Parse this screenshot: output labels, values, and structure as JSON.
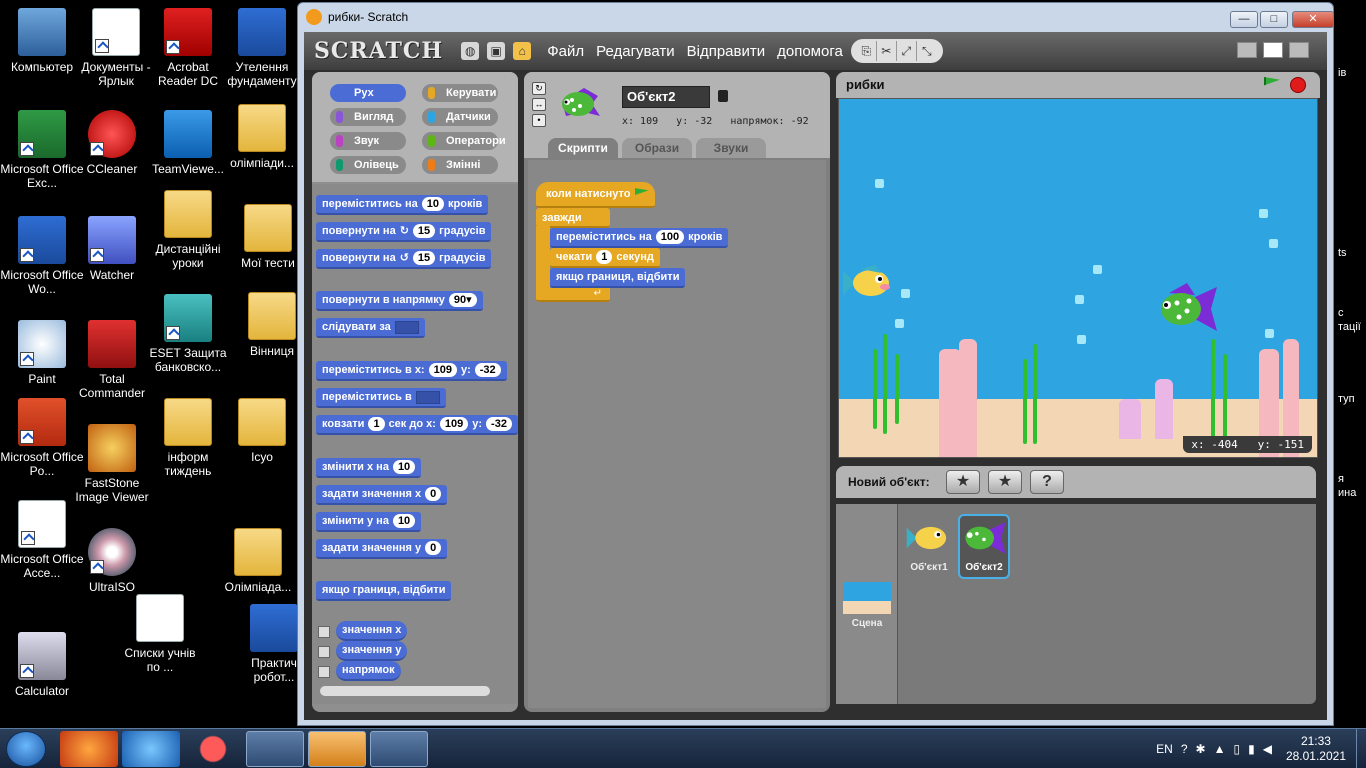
{
  "desktop": {
    "icons": [
      {
        "label": "Компьютер"
      },
      {
        "label": "Документы - Ярлык"
      },
      {
        "label": "Acrobat Reader DC"
      },
      {
        "label": "Утелення фундаменту"
      },
      {
        "label": "Microsoft Office Exc..."
      },
      {
        "label": "CCleaner"
      },
      {
        "label": "TeamViewe..."
      },
      {
        "label": "олімпіади..."
      },
      {
        "label": "Microsoft Office Wo..."
      },
      {
        "label": "Watcher"
      },
      {
        "label": "Дистанційні уроки"
      },
      {
        "label": "Мої тести"
      },
      {
        "label": "Paint"
      },
      {
        "label": "Total Commander"
      },
      {
        "label": "ESET Защита банковско..."
      },
      {
        "label": "Вінниця"
      },
      {
        "label": "Microsoft Office Po..."
      },
      {
        "label": "FastStone Image Viewer"
      },
      {
        "label": "інформ тиждень"
      },
      {
        "label": "Ісуо"
      },
      {
        "label": "Microsoft Office Acce..."
      },
      {
        "label": "UltraISO"
      },
      {
        "label": "Олімпіада..."
      },
      {
        "label": "Списки учнів по ..."
      },
      {
        "label": "Практич робот..."
      },
      {
        "label": "Calculator"
      }
    ],
    "right_edge": [
      "ів",
      "ts",
      "с",
      "тації",
      "туп",
      "я",
      "ина"
    ]
  },
  "window": {
    "title": "рибки- Scratch",
    "btn_min": "—",
    "btn_max": "□",
    "btn_close": "✕"
  },
  "menubar": {
    "logo": "SCRATCH",
    "items": [
      "Файл",
      "Редагувати",
      "Відправити",
      "допомога"
    ]
  },
  "categories": [
    {
      "label": "Рух",
      "color": "#4a6cd4",
      "selected": true
    },
    {
      "label": "Керувати",
      "color": "#e6a822",
      "selected": false
    },
    {
      "label": "Вигляд",
      "color": "#8a55d7",
      "selected": false
    },
    {
      "label": "Датчики",
      "color": "#2ca5e2",
      "selected": false
    },
    {
      "label": "Звук",
      "color": "#bb42c3",
      "selected": false
    },
    {
      "label": "Оператори",
      "color": "#5cb712",
      "selected": false
    },
    {
      "label": "Олівець",
      "color": "#0e9a6c",
      "selected": false
    },
    {
      "label": "Змінні",
      "color": "#ee7d16",
      "selected": false
    }
  ],
  "palette": {
    "move": {
      "a": "переміститись на",
      "v": "10",
      "b": "кроків"
    },
    "turn_cw": {
      "a": "повернути на",
      "icon": "↻",
      "v": "15",
      "b": "градусів"
    },
    "turn_ccw": {
      "a": "повернути на",
      "icon": "↺",
      "v": "15",
      "b": "градусів"
    },
    "point_dir": {
      "a": "повернути в напрямку",
      "v": "90▾"
    },
    "follow": {
      "a": "слідувати за"
    },
    "goto_xy": {
      "a": "переміститись в x:",
      "x": "109",
      "b": "y:",
      "y": "-32"
    },
    "goto": {
      "a": "переміститись в"
    },
    "glide": {
      "a": "ковзати",
      "s": "1",
      "b": "сек до x:",
      "x": "109",
      "c": "y:",
      "y": "-32"
    },
    "change_x": {
      "a": "змінити x на",
      "v": "10"
    },
    "set_x": {
      "a": "задати значення x",
      "v": "0"
    },
    "change_y": {
      "a": "змінити y на",
      "v": "10"
    },
    "set_y": {
      "a": "задати значення y",
      "v": "0"
    },
    "bounce": {
      "a": "якщо границя, відбити"
    },
    "rep_x": "значення x",
    "rep_y": "значення y",
    "rep_dir": "напрямок"
  },
  "sprite": {
    "name": "Об'єкт2",
    "coords": "x: 109   y: -32   напрямок: -92",
    "tabs": [
      "Скрипти",
      "Образи",
      "Звуки"
    ]
  },
  "script": {
    "hat": "коли натиснуто",
    "forever": "завжди",
    "move_a": "переміститись на",
    "move_v": "100",
    "move_b": "кроків",
    "wait_a": "чекати",
    "wait_v": "1",
    "wait_b": "секунд",
    "bounce": "якщо границя, відбити"
  },
  "stage": {
    "title": "рибки",
    "mouse": "x: -404   y: -151"
  },
  "new_sprite": {
    "label": "Новий об'єкт:",
    "paint": "★",
    "choose": "★",
    "random": "?"
  },
  "sprites": [
    {
      "label": "Об'єкт1"
    },
    {
      "label": "Об'єкт2"
    }
  ],
  "stage_thumb": {
    "label": "Сцена"
  },
  "taskbar": {
    "lang": "EN",
    "time": "21:33",
    "date": "28.01.2021"
  }
}
